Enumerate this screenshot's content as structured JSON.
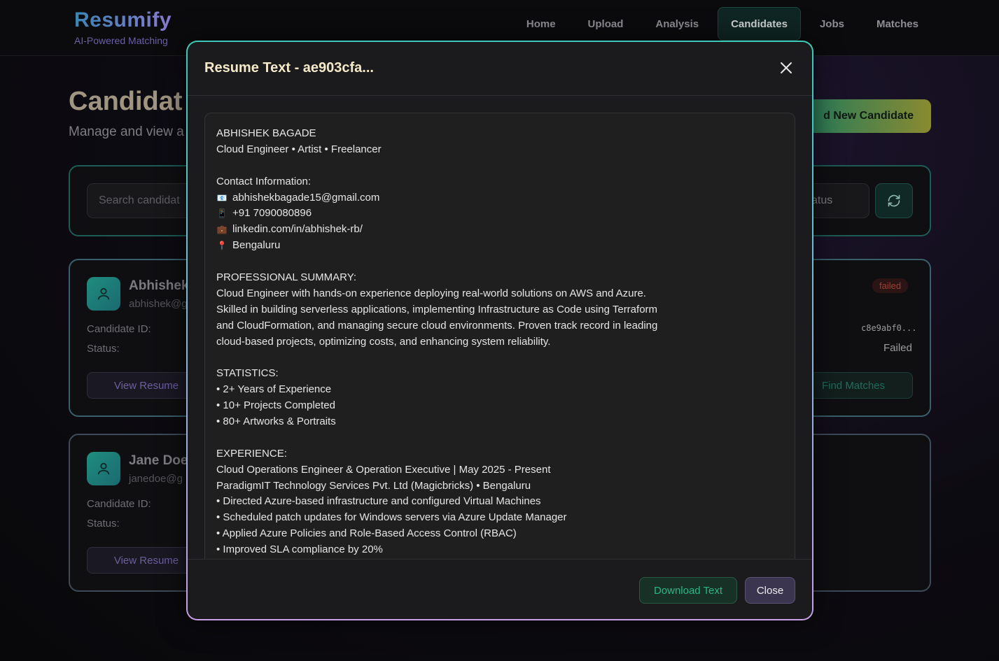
{
  "app": {
    "title": "Resumify",
    "subtitle": "AI-Powered Matching"
  },
  "nav": {
    "items": [
      {
        "label": "Home"
      },
      {
        "label": "Upload"
      },
      {
        "label": "Analysis"
      },
      {
        "label": "Candidates",
        "active": true
      },
      {
        "label": "Jobs"
      },
      {
        "label": "Matches"
      }
    ]
  },
  "page": {
    "title": "Candidat",
    "subtitle": "Manage and view a",
    "add_button": "d New Candidate",
    "search_placeholder": "Search candidat",
    "status_filter": "atus",
    "refresh_icon": "refresh-icon"
  },
  "candidates": [
    {
      "name": "Abhishek",
      "email": "abhishek@g",
      "id_label": "Candidate ID:",
      "status_label": "Status:",
      "id_value": "c8e9abf0...",
      "status_value": "Failed",
      "badge": "failed",
      "view_label": "View Resume",
      "match_label": "Find Matches"
    },
    {
      "name": "Jane Doe",
      "email": "janedoe@g",
      "id_label": "Candidate ID:",
      "status_label": "Status:",
      "view_label": "View Resume"
    }
  ],
  "modal": {
    "title": "Resume Text - ae903cfa...",
    "lines": [
      {
        "text": "ABHISHEK BAGADE"
      },
      {
        "text": "Cloud Engineer • Artist • Freelancer"
      },
      {
        "text": ""
      },
      {
        "text": "Contact Information:"
      },
      {
        "icon": "📧",
        "text": "abhishekbagade15@gmail.com"
      },
      {
        "icon": "📱",
        "text": "+91 7090080896"
      },
      {
        "icon": "💼",
        "text": "linkedin.com/in/abhishek-rb/"
      },
      {
        "icon": "📍",
        "text": "Bengaluru"
      },
      {
        "text": ""
      },
      {
        "text": "PROFESSIONAL SUMMARY:"
      },
      {
        "text": "Cloud Engineer with hands-on experience deploying real-world solutions on AWS and Azure."
      },
      {
        "text": "Skilled in building serverless applications, implementing Infrastructure as Code using Terraform"
      },
      {
        "text": "and CloudFormation, and managing secure cloud environments. Proven track record in leading"
      },
      {
        "text": "cloud-based projects, optimizing costs, and enhancing system reliability."
      },
      {
        "text": ""
      },
      {
        "text": "STATISTICS:"
      },
      {
        "text": "• 2+ Years of Experience"
      },
      {
        "text": "• 10+ Projects Completed"
      },
      {
        "text": "• 80+ Artworks & Portraits"
      },
      {
        "text": ""
      },
      {
        "text": "EXPERIENCE:"
      },
      {
        "text": "Cloud Operations Engineer & Operation Executive | May 2025 - Present"
      },
      {
        "text": "ParadigmIT Technology Services Pvt. Ltd (Magicbricks) • Bengaluru"
      },
      {
        "text": "• Directed Azure-based infrastructure and configured Virtual Machines"
      },
      {
        "text": "• Scheduled patch updates for Windows servers via Azure Update Manager"
      },
      {
        "text": "• Applied Azure Policies and Role-Based Access Control (RBAC)"
      },
      {
        "text": "• Improved SLA compliance by 20%"
      }
    ],
    "download_label": "Download Text",
    "close_label": "Close"
  }
}
